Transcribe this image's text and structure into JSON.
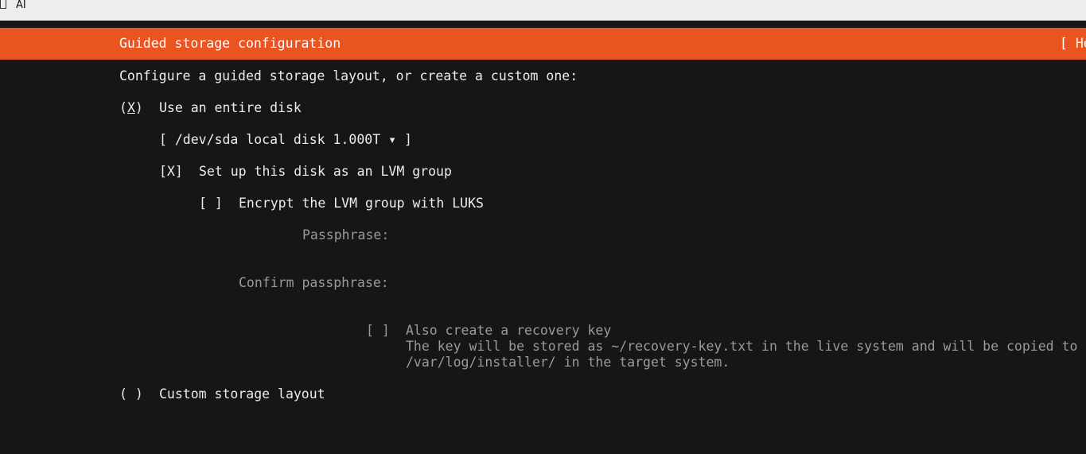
{
  "window": {
    "title": "AI"
  },
  "header": {
    "title": "Guided storage configuration",
    "help": "[ He"
  },
  "intro": "Configure a guided storage layout, or create a custom one:",
  "entire_disk": {
    "radio_open": "(",
    "radio_mark": "X",
    "radio_close": ")",
    "label": "Use an entire disk",
    "disk_select": "[ /dev/sda local disk 1.000T ▾ ]",
    "lvm_checkbox": "[X]",
    "lvm_label": "Set up this disk as an LVM group",
    "encrypt_checkbox": "[ ]",
    "encrypt_label": "Encrypt the LVM group with LUKS",
    "passphrase_label": "Passphrase:",
    "confirm_label": "Confirm passphrase:",
    "recovery_checkbox": "[ ]",
    "recovery_label": "Also create a recovery key",
    "recovery_desc_line1": "The key will be stored as ~/recovery-key.txt in the live system and will be copied to",
    "recovery_desc_line2": "/var/log/installer/ in the target system."
  },
  "custom": {
    "radio": "( )",
    "label": "Custom storage layout"
  },
  "colors": {
    "accent": "#e95420",
    "background": "#161616",
    "text": "#ececec",
    "dimmed": "#9a9a9a"
  }
}
